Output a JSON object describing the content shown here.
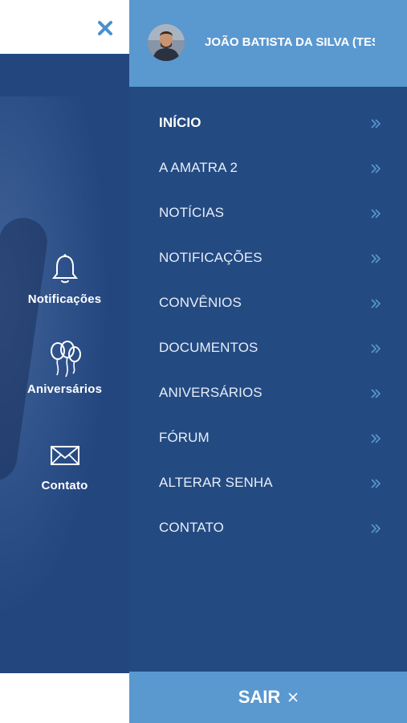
{
  "user": {
    "name": "JOÃO BATISTA DA SILVA (TESTE)"
  },
  "menu": {
    "items": [
      {
        "label": "INÍCIO",
        "active": true
      },
      {
        "label": "A AMATRA 2"
      },
      {
        "label": "NOTÍCIAS"
      },
      {
        "label": "NOTIFICAÇÕES"
      },
      {
        "label": "CONVÊNIOS"
      },
      {
        "label": "DOCUMENTOS"
      },
      {
        "label": "ANIVERSÁRIOS"
      },
      {
        "label": "FÓRUM"
      },
      {
        "label": "ALTERAR SENHA"
      },
      {
        "label": "CONTATO"
      }
    ]
  },
  "shortcuts": [
    {
      "label": "Notificações",
      "icon": "bell-icon"
    },
    {
      "label": "Aniversários",
      "icon": "balloons-icon"
    },
    {
      "label": "Contato",
      "icon": "envelope-icon"
    }
  ],
  "logout": {
    "label": "SAIR",
    "icon": "close-icon"
  },
  "close": {
    "icon": "close-icon"
  },
  "colors": {
    "drawer_bg": "#244a82",
    "header_bg": "#5a98d0",
    "left_bg": "#23467f",
    "chevron": "#5a98d0"
  }
}
